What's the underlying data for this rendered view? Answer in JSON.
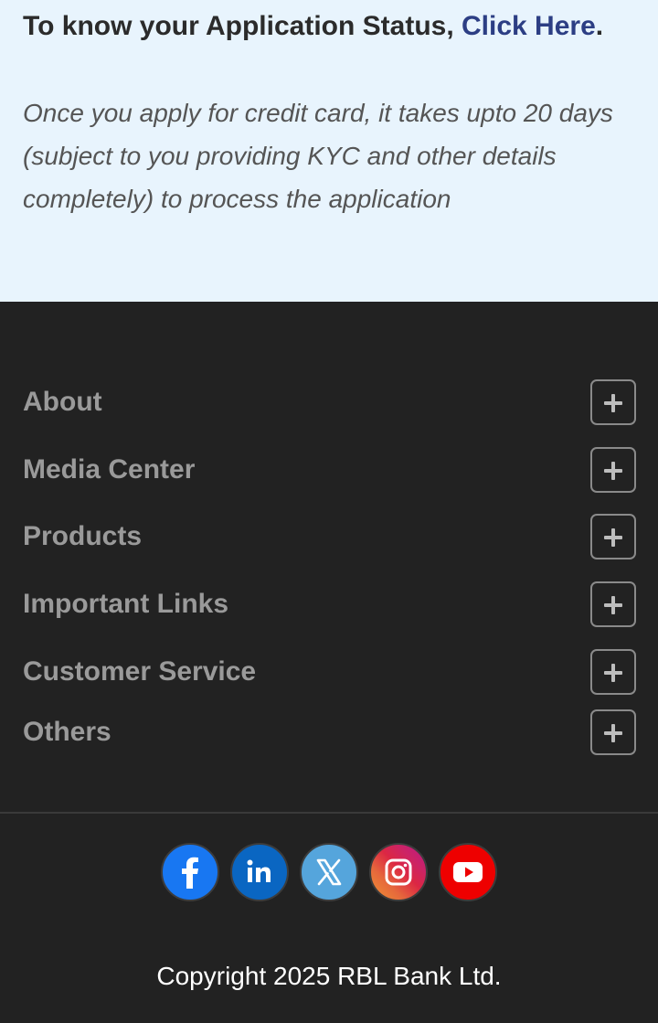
{
  "status": {
    "heading_prefix": "To know your Application Status, ",
    "link_text": "Click Here",
    "heading_suffix": ".",
    "note": "Once you apply for credit card, it takes upto 20 days (subject to you providing KYC and other details completely) to process the application"
  },
  "footer": {
    "sections": [
      {
        "label": "About"
      },
      {
        "label": "Media Center"
      },
      {
        "label": "Products"
      },
      {
        "label": "Important Links"
      },
      {
        "label": "Customer Service"
      },
      {
        "label": "Others"
      }
    ],
    "social": [
      {
        "icon": "facebook-icon",
        "color": "#1877f2"
      },
      {
        "icon": "linkedin-icon",
        "color": "#0a66c2"
      },
      {
        "icon": "x-twitter-icon",
        "color": "#55a5dc"
      },
      {
        "icon": "instagram-icon",
        "color": "#dc2743"
      },
      {
        "icon": "youtube-icon",
        "color": "#ee0000"
      }
    ],
    "copyright": "Copyright 2025 RBL Bank Ltd."
  }
}
